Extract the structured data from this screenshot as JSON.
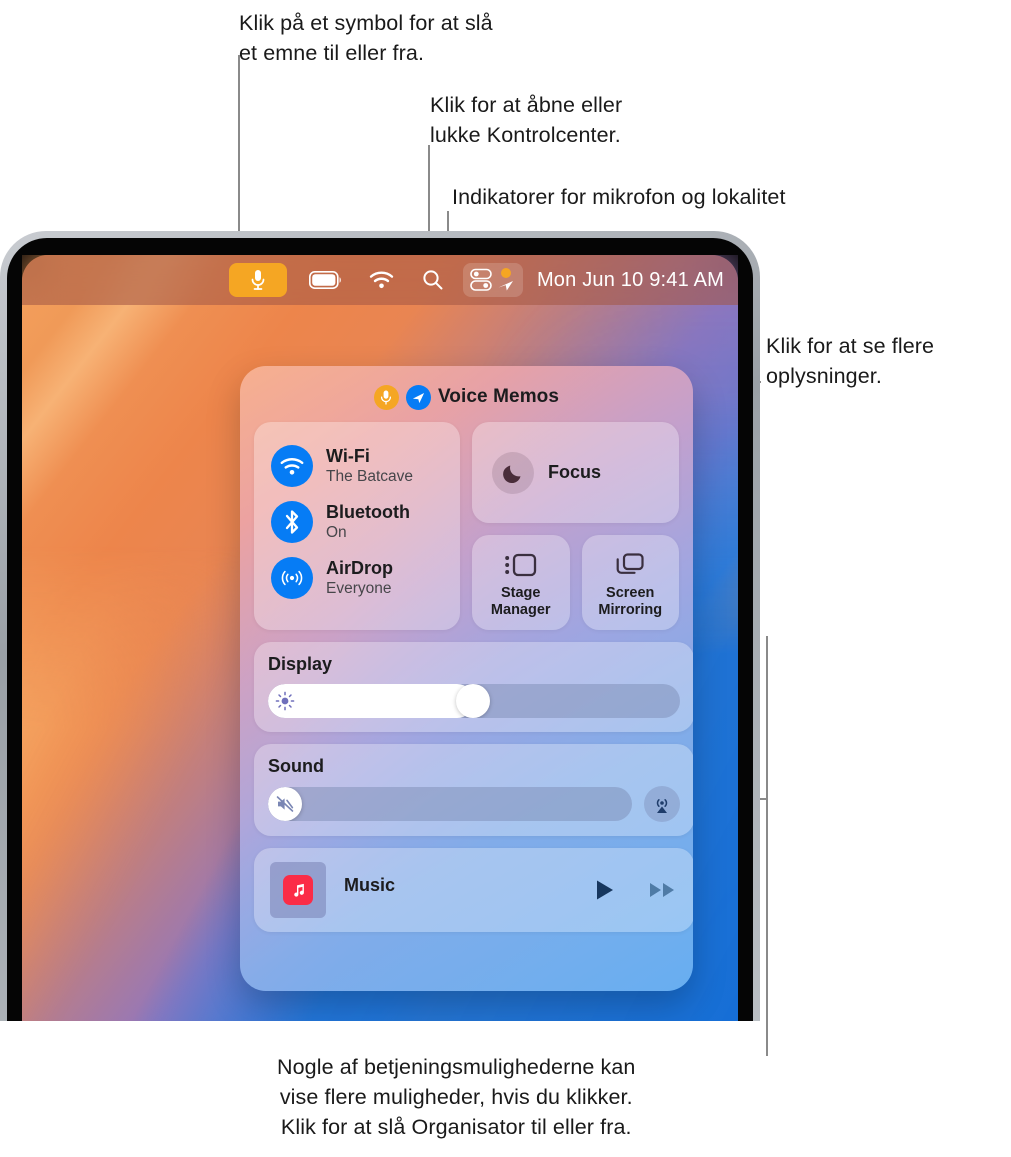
{
  "annotations": {
    "toggle_item": "Klik på et symbol for at slå\net emne til eller fra.",
    "open_close": "Klik for at åbne eller\nlukke Kontrolcenter.",
    "indicators": "Indikatorer for mikrofon og lokalitet",
    "more_info": "Klik for at se flere\noplysninger.",
    "bottom": "Nogle af betjeningsmulighederne kan\nvise flere muligheder, hvis du klikker.\nKlik for at slå Organisator til eller fra."
  },
  "menubar": {
    "mic_indicator_icon": "microphone-icon",
    "battery_icon": "battery-icon",
    "wifi_icon": "wifi-icon",
    "search_icon": "search-icon",
    "control_center_icon": "control-center-icon",
    "mic_dot_icon": "orange-dot-indicator",
    "location_icon": "location-arrow-icon",
    "clock": "Mon Jun 10  9:41 AM"
  },
  "control_center": {
    "header": {
      "mic_icon": "microphone-icon",
      "location_icon": "location-arrow-icon",
      "label": "Voice Memos"
    },
    "connectivity": [
      {
        "icon": "wifi-icon",
        "title": "Wi-Fi",
        "subtitle": "The Batcave"
      },
      {
        "icon": "bluetooth-icon",
        "title": "Bluetooth",
        "subtitle": "On"
      },
      {
        "icon": "airdrop-icon",
        "title": "AirDrop",
        "subtitle": "Everyone"
      }
    ],
    "focus": {
      "icon": "moon-icon",
      "label": "Focus"
    },
    "stage_manager": {
      "icon": "stage-manager-icon",
      "label": "Stage\nManager"
    },
    "screen_mirroring": {
      "icon": "screen-mirroring-icon",
      "label": "Screen\nMirroring"
    },
    "display": {
      "label": "Display",
      "icon": "brightness-icon",
      "value_percent": 50
    },
    "sound": {
      "label": "Sound",
      "icon": "mute-speaker-icon",
      "value_percent": 0,
      "airplay_icon": "airplay-audio-icon"
    },
    "music": {
      "label": "Music",
      "app_icon": "music-note-icon",
      "play_icon": "play-icon",
      "forward_icon": "fast-forward-icon"
    }
  },
  "colors": {
    "accent_orange": "#f5a623",
    "accent_blue": "#067cf5",
    "music_red": "#fb2c47",
    "leader_line": "#8a8a8a"
  }
}
